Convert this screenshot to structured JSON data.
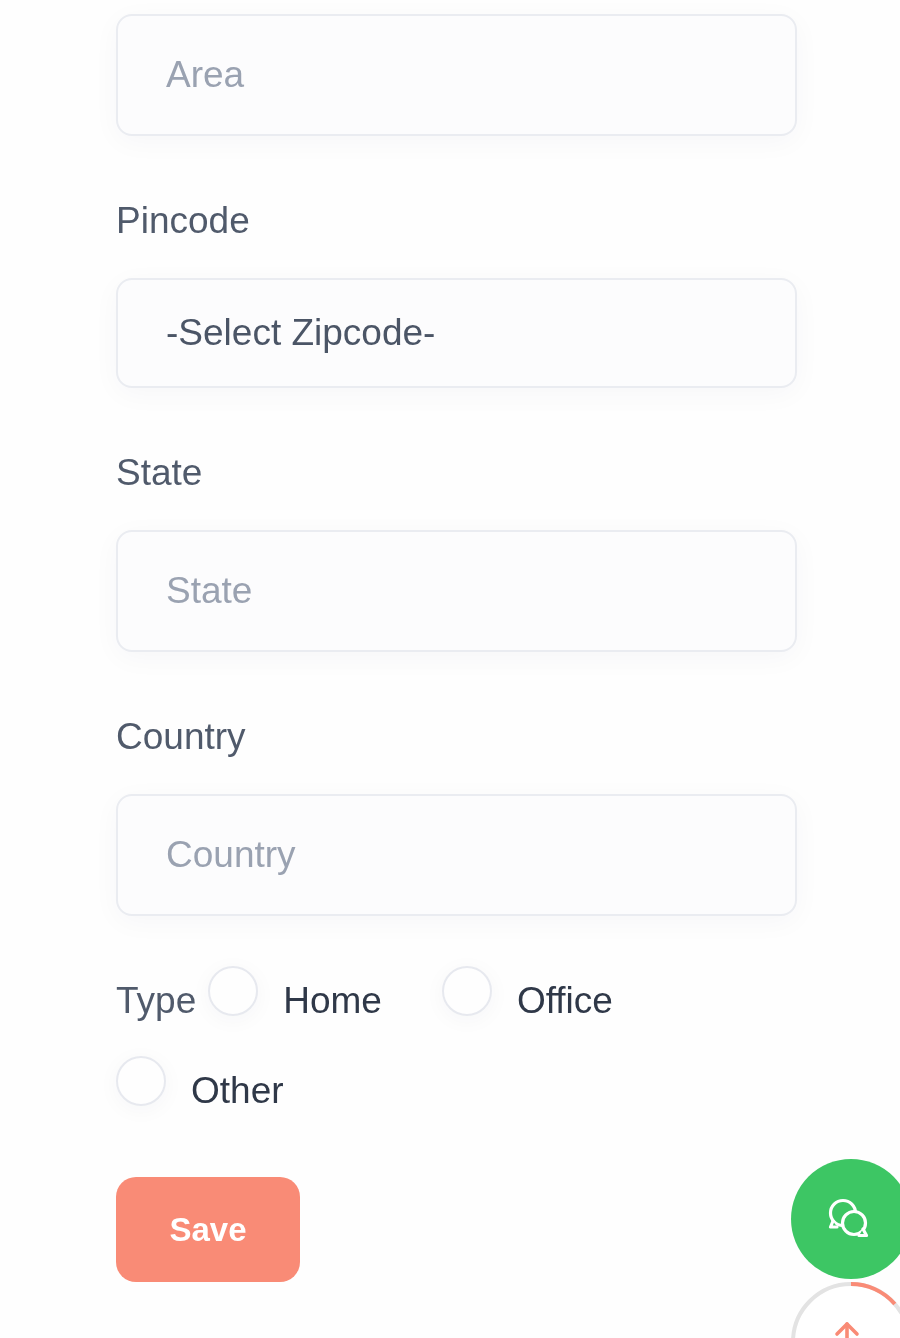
{
  "fields": [
    {
      "kind": "input",
      "placeholder": "Area"
    },
    {
      "kind": "select",
      "label": "Pincode",
      "value": "-Select Zipcode-"
    },
    {
      "kind": "input",
      "label": "State",
      "placeholder": "State"
    },
    {
      "kind": "input",
      "label": "Country",
      "placeholder": "Country"
    }
  ],
  "type": {
    "label": "Type",
    "options": [
      {
        "label": "Home",
        "selected": false
      },
      {
        "label": "Office",
        "selected": false
      },
      {
        "label": "Other",
        "selected": false
      }
    ]
  },
  "save_button": {
    "label": "Save"
  }
}
